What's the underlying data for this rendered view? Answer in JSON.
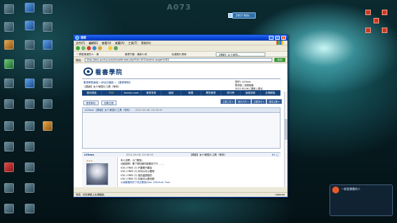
{
  "desktop": {
    "wallpaper_text": "A073",
    "notification_badge": "2607 KB/s",
    "chat_panel_title": "一群愛畫畫的人"
  },
  "window": {
    "title": "搜索",
    "controls": {
      "minimize": "_",
      "maximize": "□",
      "close": "×"
    }
  },
  "menu": [
    "文件(F)",
    "编辑(E)",
    "查看(V)",
    "收藏(A)",
    "工具(T)",
    "帮助(H)"
  ],
  "toolbar": {
    "address_caption": "地址"
  },
  "tabs": [
    {
      "label": "一群愛畫畫的人 - 畫",
      "active": false
    },
    {
      "label": "爱看书屋 - 最新小说",
      "active": false
    },
    {
      "label": "百度图片搜索",
      "active": false
    },
    {
      "label": "【看影】女十家园...",
      "active": true
    }
  ],
  "address": {
    "url": "http://bbs.pczlcy.com/showthread.php?tid=301&extra=page%3D1",
    "go_label": "转到"
  },
  "site": {
    "logo_text": "看書學院",
    "breadcrumb": "看書學院論壇 » 綜合討論區 » 【看書學院】",
    "thread_heading": "【原創】女十家园小工具（有料）",
    "user_lines": [
      "您好!, x23ous",
      "短消息 | 控制面板",
      "2012-05-06 | 搜索 | 退出"
    ],
    "nav": [
      "發帖樣板",
      "RSS",
      "kanshu.com",
      "看書會員",
      "論壇",
      "聯盟",
      "標签管理",
      "排行榜",
      "論壇幫助",
      "友情鏈接"
    ],
    "nav_highlight_index": 1,
    "buttons": [
      "發表新帖",
      "回覆主題"
    ],
    "dropdowns": [
      "主題工具 ▾",
      "顯示方式 ▾",
      "主題評分 ▾",
      "搜尋主題 ▾"
    ],
    "thread_title_bar": "x23ous 【原創】女十家园小工具（有料）",
    "thread_date": "2012-05-06, 20:18:15"
  },
  "post": {
    "author": "x23ous",
    "meta": "2012-05-06, 20:18:15",
    "title": "【原創】女十家园小工具（有料）",
    "tools": "#1 ▢",
    "rank_icons": "★★★",
    "lines": [
      "本人沒帶，小门號到，",
      "功能說明：看了就知道可能做到了什 , , , ,",
      "V30 / FREE (?)  不要看不要說",
      "V30 / FREE (?)  向可以可以看錢",
      "V30 / FREE (?)  真的還是假的",
      "V30 / FREE (?)  向後可以看到錢",
      "以後都要改好了也沒看到(tool, 208,Yuo1 Yuo1"
    ]
  },
  "status": {
    "left": "完成，但在網頁上出現錯誤。",
    "right": "Internet"
  }
}
